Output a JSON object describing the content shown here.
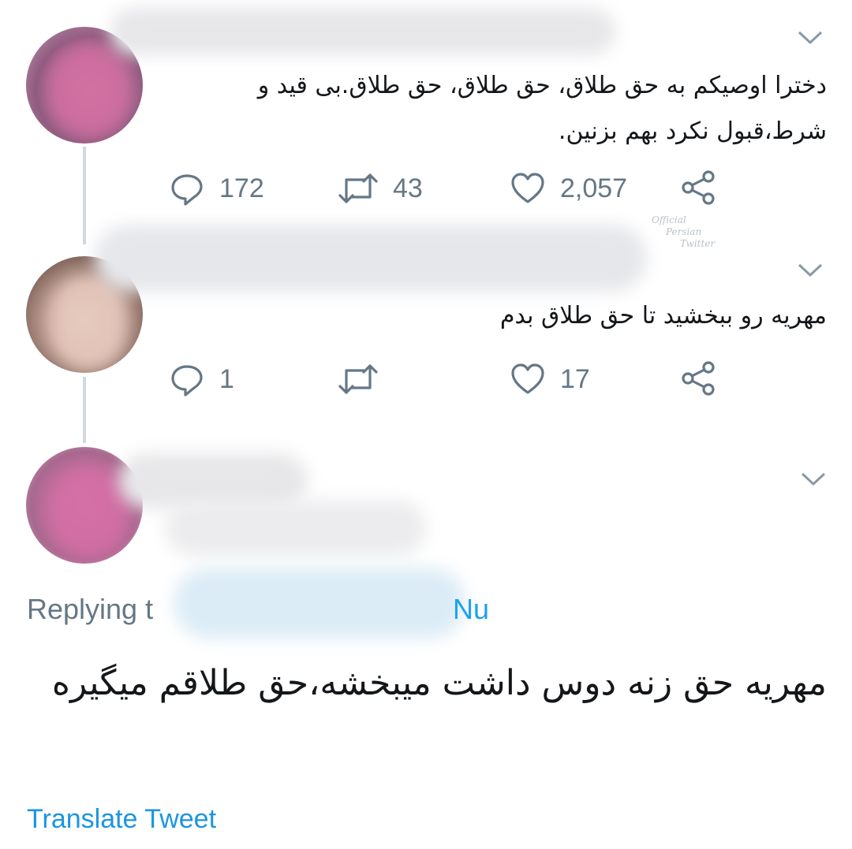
{
  "tweets": [
    {
      "text": "دخترا اوصیکم به حق طلاق، حق طلاق، حق طلاق.بی قید و شرط،قبول نکرد بهم بزنین.",
      "replies": "172",
      "retweets": "43",
      "likes": "2,057"
    },
    {
      "text": "مهریه رو ببخشید تا حق طلاق بدم",
      "replies": "1",
      "retweets": "",
      "likes": "17"
    }
  ],
  "main_tweet": {
    "replying_prefix": "Replying t",
    "replying_suffix": "Nu",
    "text": "مهریه حق زنه دوس داشت میبخشه،حق طلاقم میگیره",
    "translate_label": "Translate Tweet"
  },
  "watermark": [
    "Official",
    "Persian",
    "Twitter"
  ],
  "colors": {
    "text": "#14171a",
    "muted": "#657786",
    "link": "#1da1f2",
    "translate": "#1b95e0",
    "thread_line": "#cfd9de"
  },
  "icons": [
    "reply-icon",
    "retweet-icon",
    "like-icon",
    "share-icon",
    "chevron-down-icon"
  ]
}
